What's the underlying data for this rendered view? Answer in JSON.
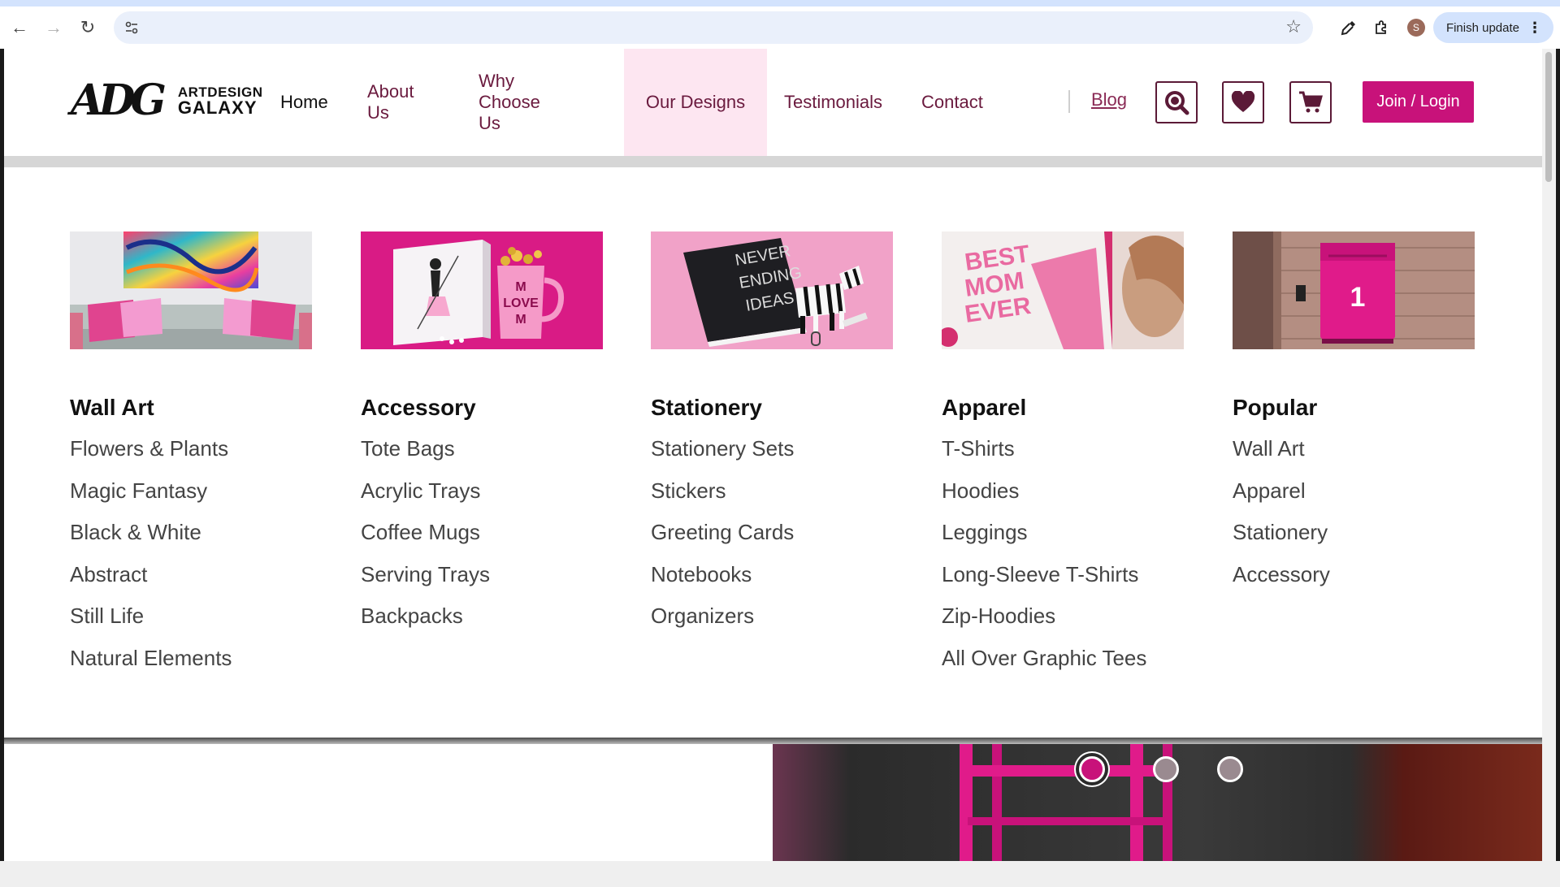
{
  "browser": {
    "finish_update_label": "Finish update",
    "profile_initial": "S",
    "icons": [
      "back-icon",
      "forward-icon",
      "reload-icon",
      "tune-icon",
      "star-icon",
      "eyedropper-icon",
      "extensions-icon",
      "more-vert-icon"
    ]
  },
  "site": {
    "brand": {
      "mark": "ADG",
      "line1": "ARTDESIGN",
      "line2": "GALAXY"
    },
    "nav": [
      {
        "id": "home",
        "label": "Home"
      },
      {
        "id": "about",
        "label": "About Us"
      },
      {
        "id": "why",
        "label": "Why Choose Us"
      },
      {
        "id": "designs",
        "label": "Our Designs"
      },
      {
        "id": "testimonials",
        "label": "Testimonials"
      },
      {
        "id": "contact",
        "label": "Contact"
      }
    ],
    "active_nav": "Our Designs",
    "blog_label": "Blog",
    "join_label": "Join / Login",
    "header_icons": [
      "search-icon",
      "heart-icon",
      "cart-icon"
    ],
    "accent_color": "#c8127a",
    "nav_text_color": "#6a1a3e"
  },
  "mega_menu": {
    "columns": [
      {
        "title": "Wall Art",
        "image": "sofa-wall-art-image",
        "items": [
          "Flowers & Plants",
          "Magic Fantasy",
          "Black & White",
          "Abstract",
          "Still Life",
          "Natural Elements"
        ]
      },
      {
        "title": "Accessory",
        "image": "love-mug-image",
        "items": [
          "Tote Bags",
          "Acrylic Trays",
          "Coffee Mugs",
          "Serving Trays",
          "Backpacks"
        ]
      },
      {
        "title": "Stationery",
        "image": "notebook-zebra-image",
        "items": [
          "Stationery Sets",
          "Stickers",
          "Greeting Cards",
          "Notebooks",
          "Organizers"
        ]
      },
      {
        "title": "Apparel",
        "image": "tshirt-image",
        "items": [
          "T-Shirts",
          "Hoodies",
          "Leggings",
          "Long-Sleeve T-Shirts",
          "Zip-Hoodies",
          "All Over Graphic Tees"
        ]
      },
      {
        "title": "Popular",
        "image": "mailbox-image",
        "items": [
          "Wall Art",
          "Apparel",
          "Stationery",
          "Accessory"
        ]
      }
    ],
    "image_texts": {
      "mug": "M\nLOVE\nM",
      "notebook": "NEVER ENDING IDEAS",
      "tshirt": "BEST MOM EVER",
      "mailbox": "1"
    }
  },
  "carousel": {
    "slide_count": 3,
    "active_index": 0
  }
}
